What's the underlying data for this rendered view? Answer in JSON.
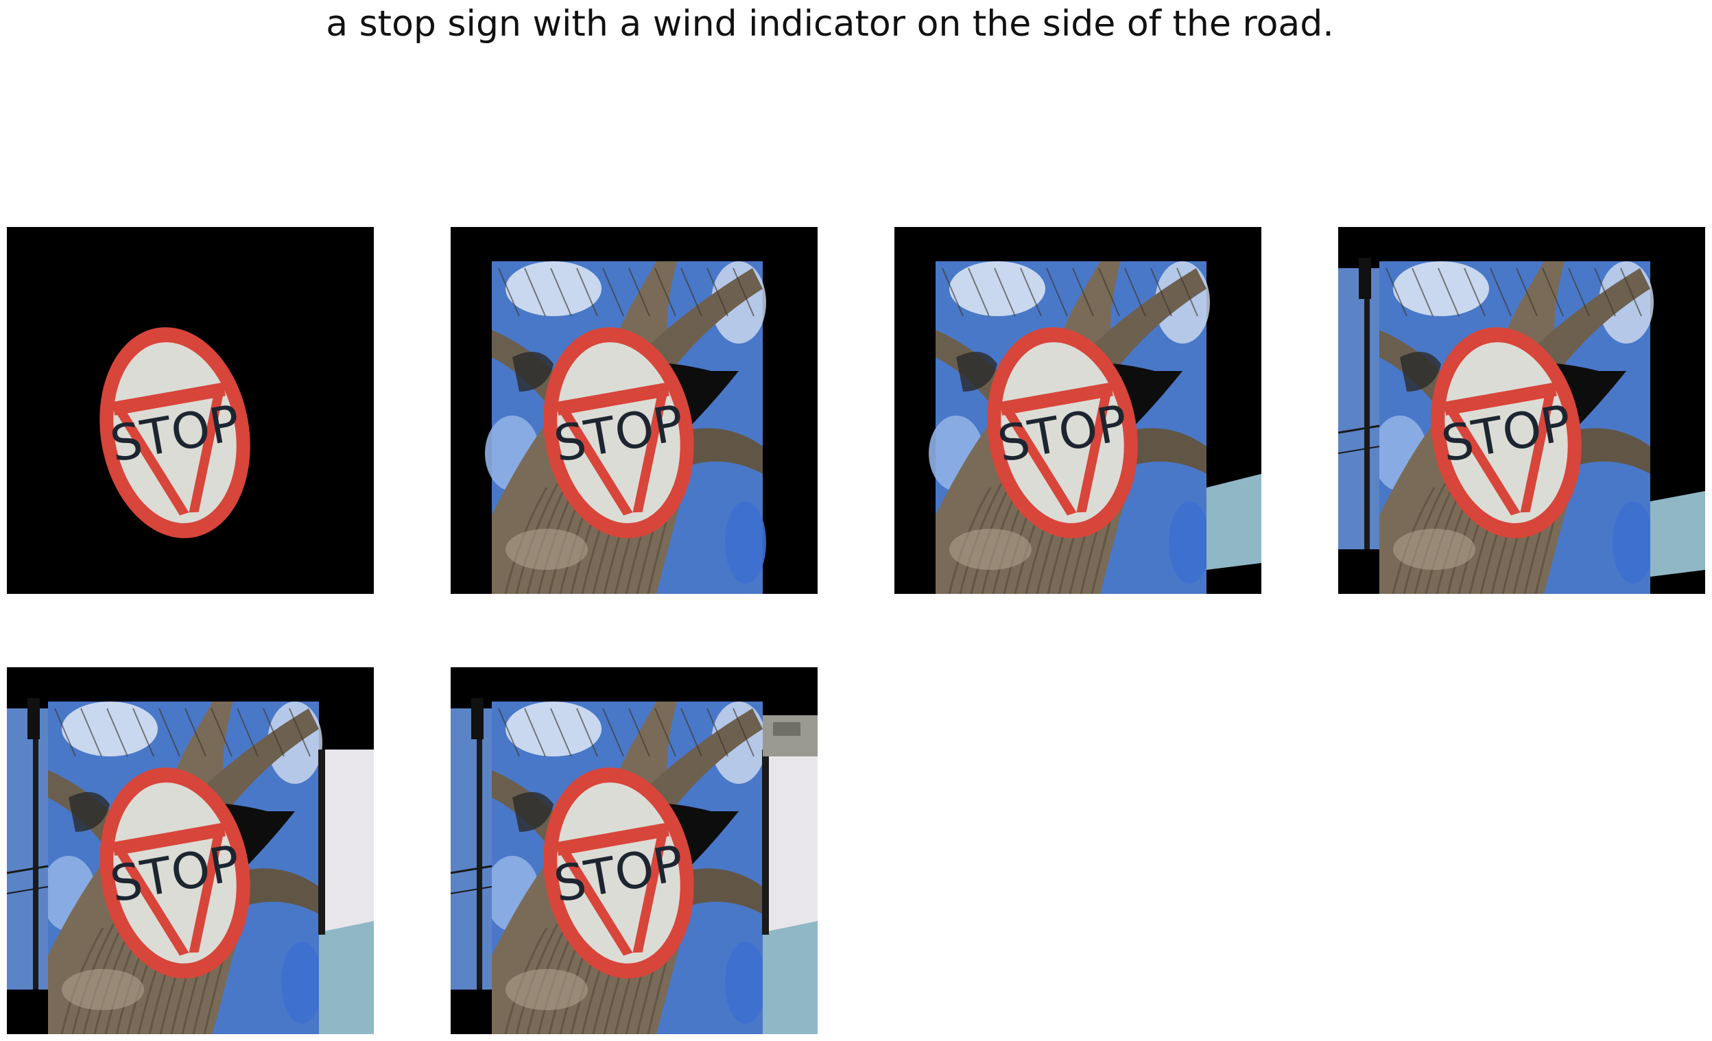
{
  "caption": "a stop sign with a wind indicator on the side of the road.",
  "sign_text": "STOP",
  "colors": {
    "sign_red": "#d8453a",
    "sign_face": "#dcdcd6",
    "sign_text": "#1c2530",
    "sky": "#4a78c8",
    "bark": "#7a6b58",
    "wall": "#e8e6ea",
    "water": "#8fb7c6"
  },
  "panels": [
    {
      "id": "panel-1",
      "layers": [
        "sign"
      ]
    },
    {
      "id": "panel-2",
      "layers": [
        "sign",
        "tree"
      ]
    },
    {
      "id": "panel-3",
      "layers": [
        "sign",
        "tree",
        "water"
      ]
    },
    {
      "id": "panel-4",
      "layers": [
        "sign",
        "tree",
        "water",
        "pole"
      ]
    },
    {
      "id": "panel-5",
      "layers": [
        "sign",
        "tree",
        "water",
        "pole",
        "wall"
      ]
    },
    {
      "id": "panel-6",
      "layers": [
        "sign",
        "tree",
        "water",
        "pole",
        "wall",
        "rock"
      ]
    }
  ]
}
